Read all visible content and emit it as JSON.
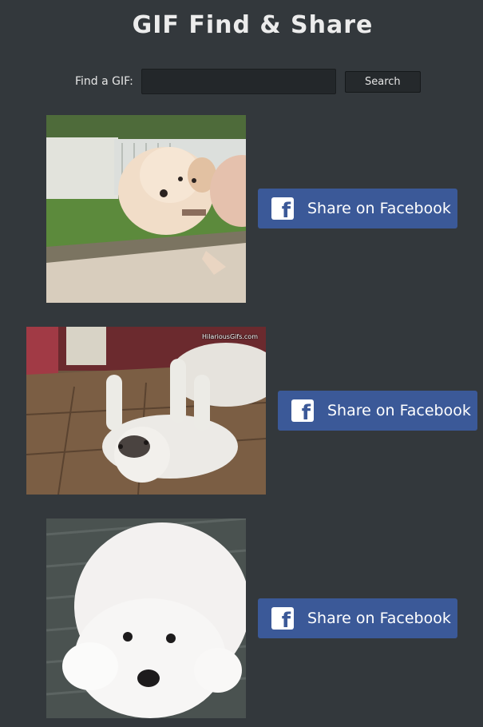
{
  "header": {
    "title": "GIF Find & Share"
  },
  "search": {
    "label": "Find a GIF:",
    "value": "",
    "placeholder": "",
    "button_label": "Search"
  },
  "results": [
    {
      "image_description": "cream puppy being held up over a garden path",
      "share_label": "Share on Facebook",
      "share_icon": "facebook-icon",
      "watermark": ""
    },
    {
      "image_description": "white puppy rolling on its back on a wooden floor",
      "share_label": "Share on Facebook",
      "share_icon": "facebook-icon",
      "watermark": "HilariousGifs.com"
    },
    {
      "image_description": "fluffy white puppy lying on a grey rug",
      "share_label": "Share on Facebook",
      "share_icon": "facebook-icon",
      "watermark": ""
    }
  ],
  "colors": {
    "background": "#33383c",
    "facebook_blue": "#3b5998",
    "title_text": "#ececec"
  }
}
